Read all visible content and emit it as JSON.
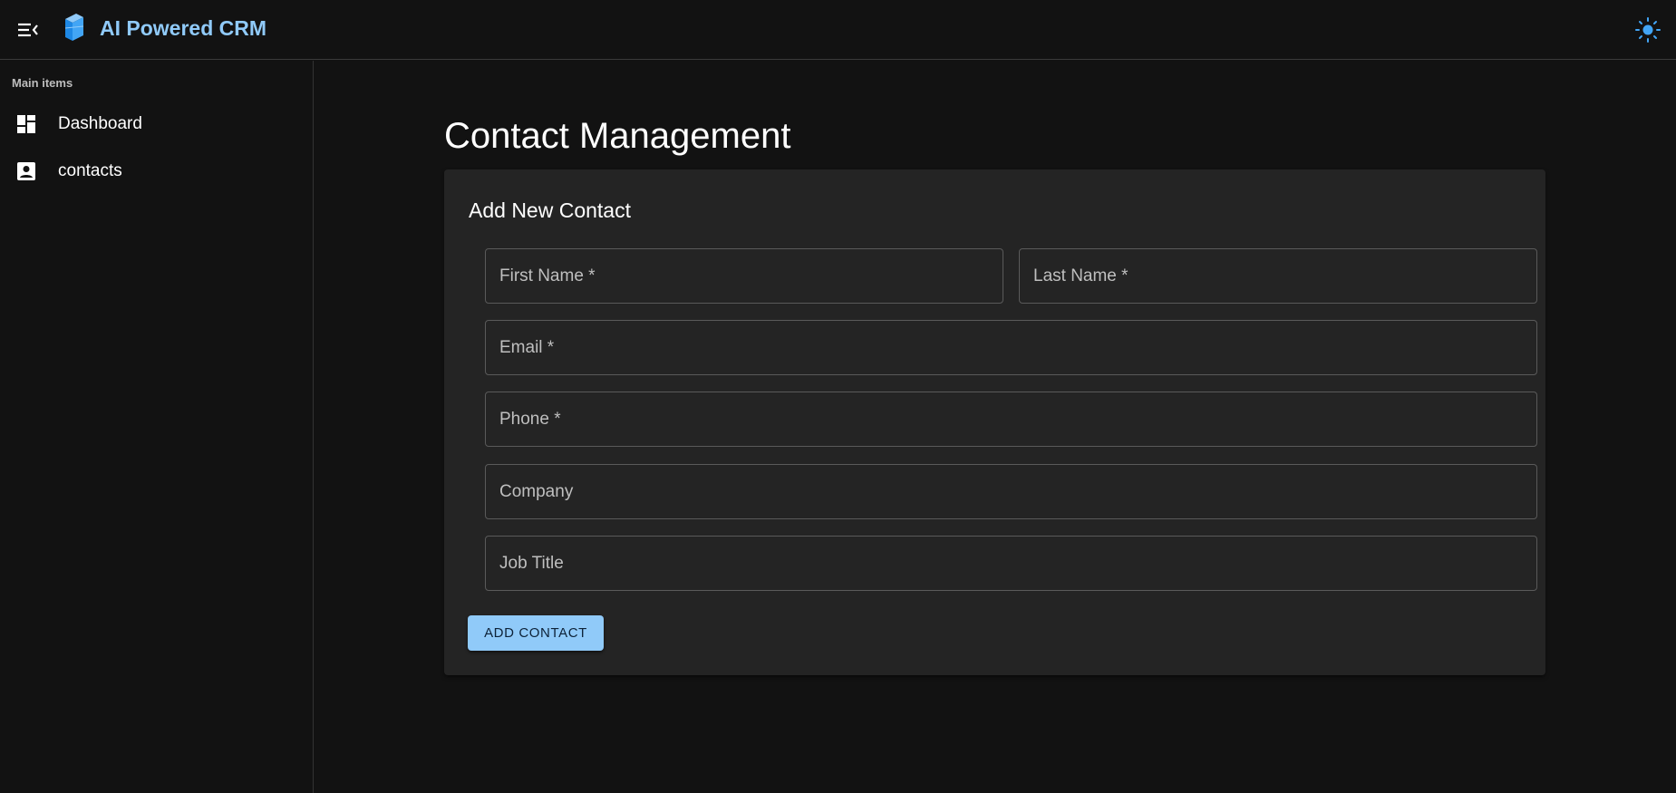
{
  "header": {
    "title": "AI Powered CRM",
    "accent": "#90caf9"
  },
  "sidebar": {
    "section_label": "Main items",
    "items": [
      {
        "label": "Dashboard",
        "icon": "dashboard-icon"
      },
      {
        "label": "contacts",
        "icon": "contact-icon"
      }
    ]
  },
  "main": {
    "title": "Contact Management"
  },
  "form": {
    "title": "Add New Contact",
    "fields": {
      "first_name": "First Name *",
      "last_name": "Last Name *",
      "email": "Email *",
      "phone": "Phone *",
      "company": "Company",
      "job_title": "Job Title"
    },
    "submit_label": "ADD CONTACT"
  }
}
